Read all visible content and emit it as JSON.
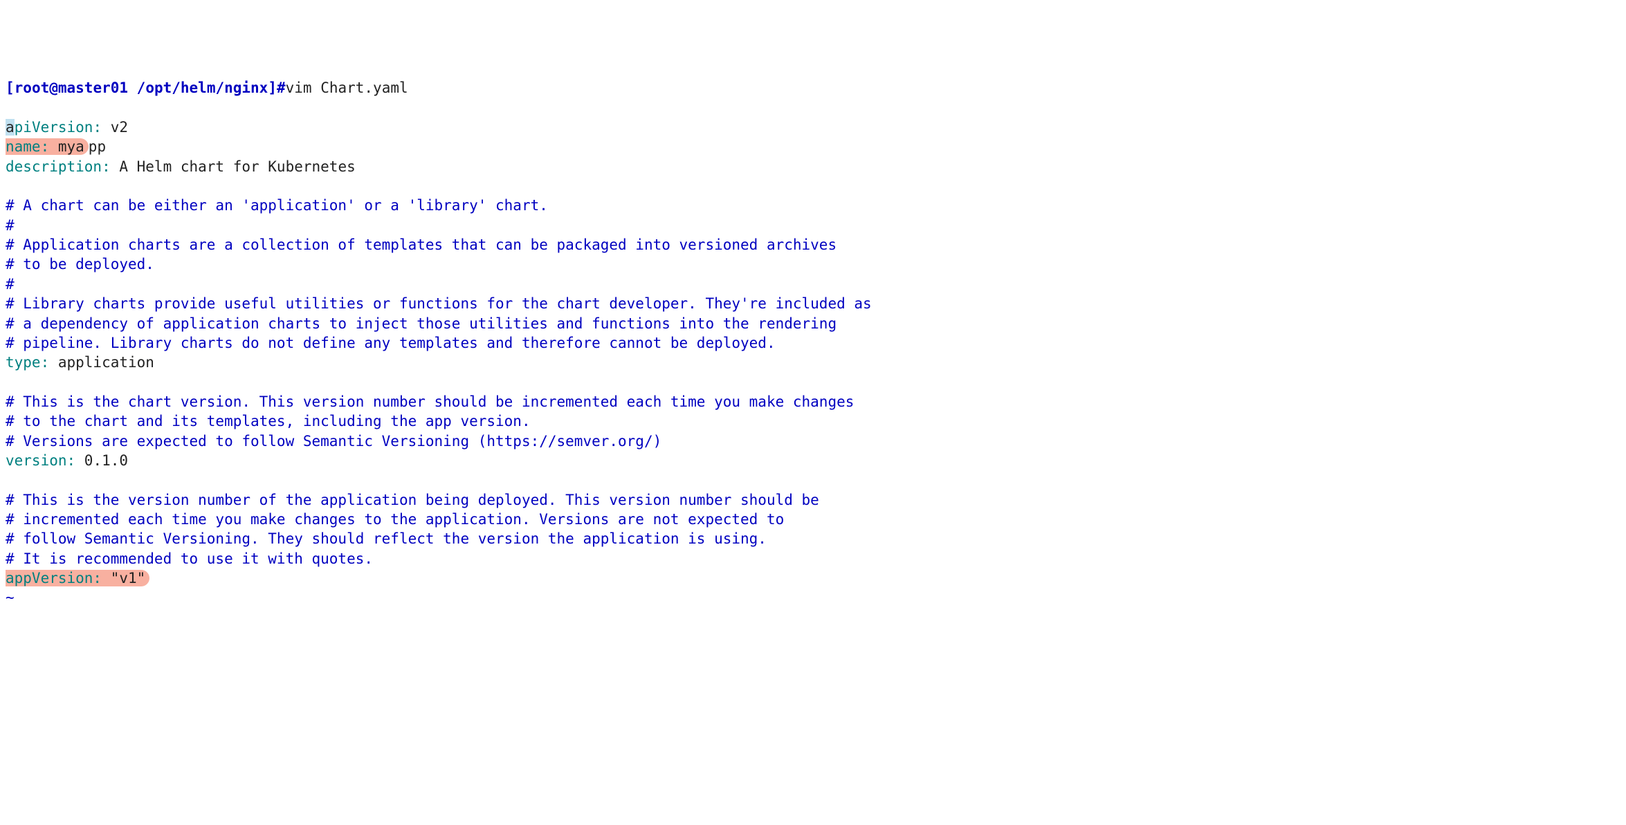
{
  "prompt": {
    "bracket_open": "[",
    "user_host": "root@master01",
    "path": " /opt/helm/nginx",
    "bracket_close": "]#",
    "command": "vim Chart.yaml"
  },
  "content": {
    "line1": {
      "key_first_char": "a",
      "key_rest": "piVersion:",
      "value": " v2"
    },
    "line2": {
      "key": "name:",
      "value_highlighted": " mya",
      "value_rest": "pp"
    },
    "line3": {
      "key": "description:",
      "value": " A Helm chart for Kubernetes"
    },
    "comment_block1": {
      "l1": "# A chart can be either an 'application' or a 'library' chart.",
      "l2": "#",
      "l3": "# Application charts are a collection of templates that can be packaged into versioned archives",
      "l4": "# to be deployed.",
      "l5": "#",
      "l6": "# Library charts provide useful utilities or functions for the chart developer. They're included as",
      "l7": "# a dependency of application charts to inject those utilities and functions into the rendering",
      "l8": "# pipeline. Library charts do not define any templates and therefore cannot be deployed."
    },
    "line4": {
      "key": "type:",
      "value": " application"
    },
    "comment_block2": {
      "l1": "# This is the chart version. This version number should be incremented each time you make changes",
      "l2": "# to the chart and its templates, including the app version.",
      "l3": "# Versions are expected to follow Semantic Versioning (https://semver.org/)"
    },
    "line5": {
      "key": "version:",
      "value": " 0.1.0"
    },
    "comment_block3": {
      "l1": "# This is the version number of the application being deployed. This version number should be",
      "l2": "# incremented each time you make changes to the application. Versions are not expected to",
      "l3": "# follow Semantic Versioning. They should reflect the version the application is using.",
      "l4": "# It is recommended to use it with quotes."
    },
    "line6": {
      "key": "appVersion:",
      "space": " ",
      "value_highlighted": "\"v1\""
    },
    "tilde": "~"
  }
}
